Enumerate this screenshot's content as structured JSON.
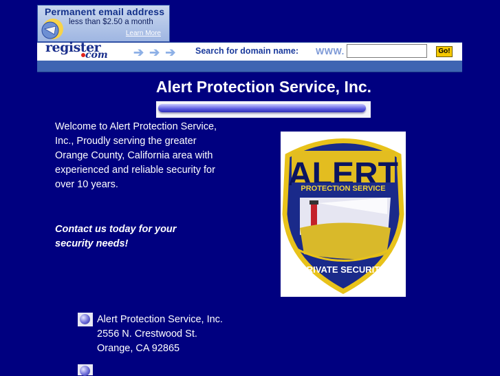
{
  "banner": {
    "promo_title": "Permanent email address",
    "promo_sub": "less than $2.50 a month",
    "promo_link": "Learn More",
    "logo_text": "register",
    "logo_suffix": "com",
    "search_label": "Search for domain name:",
    "www_prefix": "WWW.",
    "domain_value": "",
    "go_label": "Go!"
  },
  "page": {
    "title": "Alert Protection Service, Inc.",
    "welcome": "Welcome to Alert Protection Service, Inc., Proudly serving the greater Orange County, California area with experienced and reliable security for over 10 years.",
    "contact": "Contact us today for your security needs!",
    "patch_text_top": "ALERT",
    "patch_text_band": "PROTECTION SERVICE",
    "patch_text_bottom": "PRIVATE SECURITY"
  },
  "address": {
    "line1": "Alert Protection Service, Inc.",
    "line2": "2556 N. Crestwood St.",
    "line3": "Orange, CA 92865"
  },
  "colors": {
    "background": "#000080",
    "text": "#ffffff",
    "banner_stripe": "#3e64b2"
  }
}
